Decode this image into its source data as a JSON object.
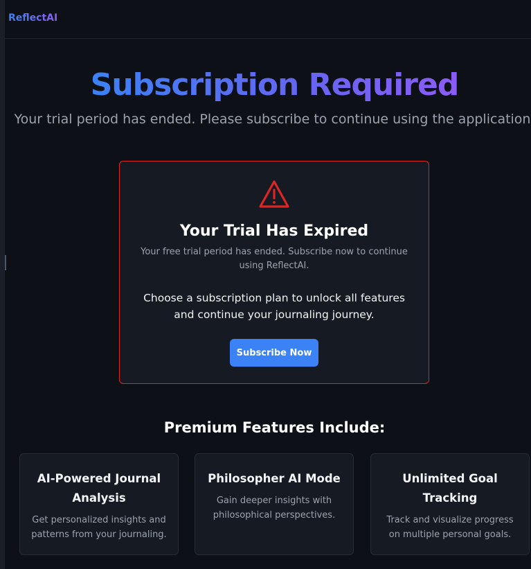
{
  "header": {
    "brand": "ReflectAI"
  },
  "hero": {
    "title": "Subscription Required",
    "subtitle": "Your trial period has ended. Please subscribe to continue using the application."
  },
  "expired_card": {
    "icon": "warning-triangle-icon",
    "title": "Your Trial Has Expired",
    "message": "Your free trial period has ended. Subscribe now to continue using ReflectAI.",
    "cta_text": "Choose a subscription plan to unlock all features and continue your journaling journey.",
    "button_label": "Subscribe Now"
  },
  "features": {
    "heading": "Premium Features Include:",
    "items": [
      {
        "title": "AI-Powered Journal Analysis",
        "description": "Get personalized insights and patterns from your journaling."
      },
      {
        "title": "Philosopher AI Mode",
        "description": "Gain deeper insights with philosophical perspectives."
      },
      {
        "title": "Unlimited Goal Tracking",
        "description": "Track and visualize progress on multiple personal goals."
      }
    ]
  },
  "colors": {
    "background": "#0d1017",
    "card": "#161a22",
    "accent_blue": "#3b82f6",
    "accent_purple": "#8b5cf6",
    "danger": "#dc2626"
  }
}
